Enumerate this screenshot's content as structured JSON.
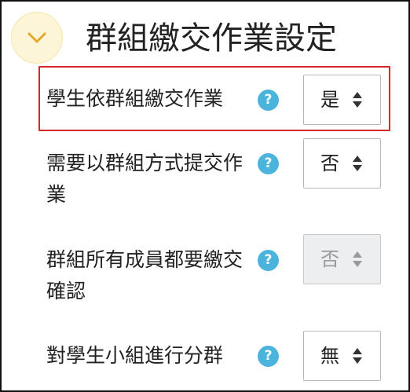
{
  "section": {
    "title": "群組繳交作業設定",
    "collapse_icon": "chevron-down-icon"
  },
  "settings": [
    {
      "label": "學生依群組繳交作業",
      "help": "?",
      "value": "是",
      "disabled": false,
      "highlighted": true
    },
    {
      "label": "需要以群組方式提交作業",
      "help": "?",
      "value": "否",
      "disabled": false
    },
    {
      "label": "群組所有成員都要繳交確認",
      "help": "?",
      "value": "否",
      "disabled": true
    },
    {
      "label": "對學生小組進行分群",
      "help": "?",
      "value": "無",
      "disabled": false
    }
  ],
  "colors": {
    "highlight_border": "#d9262c",
    "help_icon": "#4ab4dc",
    "collapse_bg": "#fdf5d7",
    "chevron": "#e2a92a"
  }
}
